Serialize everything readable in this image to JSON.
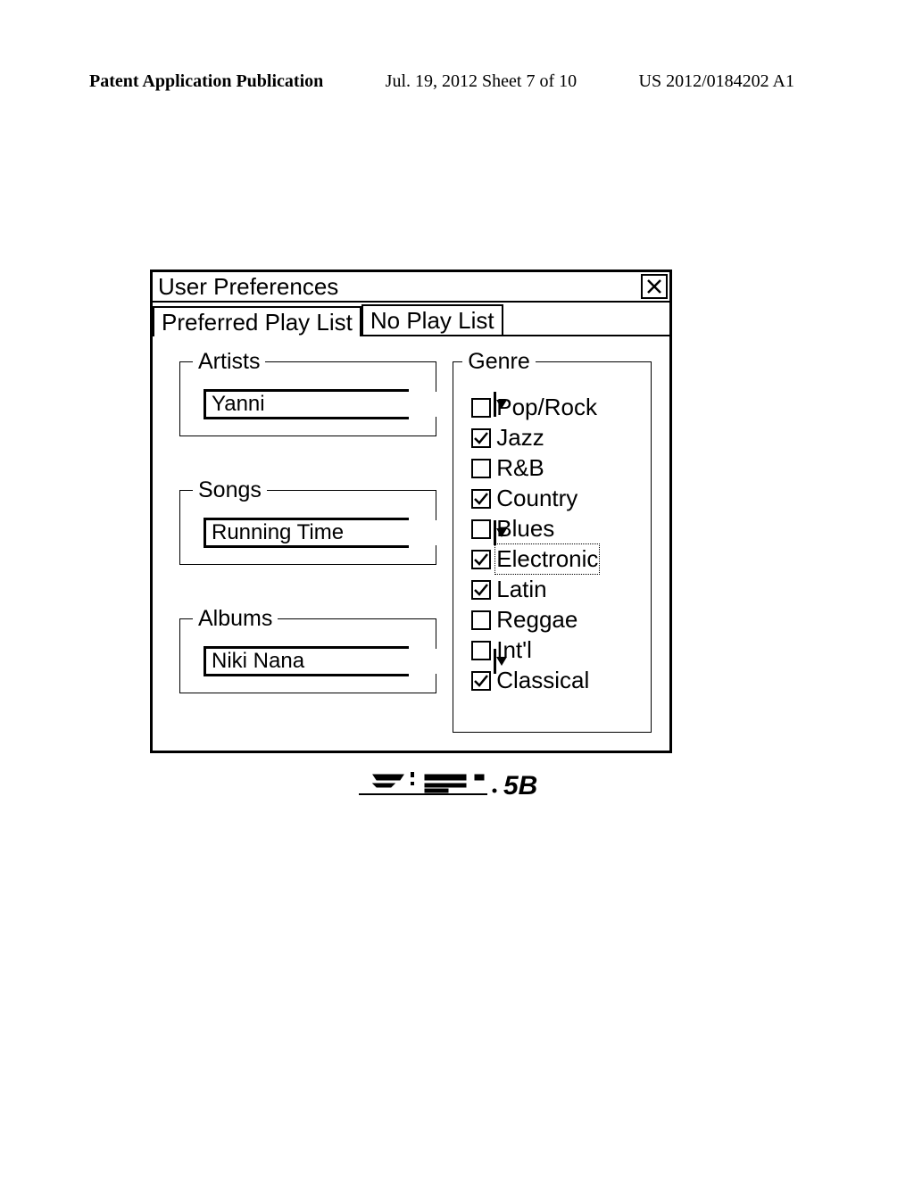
{
  "header": {
    "left": "Patent Application Publication",
    "mid": "Jul. 19, 2012  Sheet 7 of 10",
    "right": "US 2012/0184202 A1"
  },
  "dialog": {
    "title": "User Preferences",
    "tabs": [
      {
        "label": "Preferred Play List",
        "active": true
      },
      {
        "label": "No Play List",
        "active": false
      }
    ],
    "groups": {
      "artists": {
        "legend": "Artists",
        "value": "Yanni"
      },
      "songs": {
        "legend": "Songs",
        "value": "Running Time"
      },
      "albums": {
        "legend": "Albums",
        "value": "Niki Nana"
      }
    },
    "genre": {
      "legend": "Genre",
      "items": [
        {
          "label": "Pop/Rock",
          "checked": false,
          "focus": false
        },
        {
          "label": "Jazz",
          "checked": true,
          "focus": false
        },
        {
          "label": "R&B",
          "checked": false,
          "focus": false
        },
        {
          "label": "Country",
          "checked": true,
          "focus": false
        },
        {
          "label": "Blues",
          "checked": false,
          "focus": false
        },
        {
          "label": "Electronic",
          "checked": true,
          "focus": true
        },
        {
          "label": "Latin",
          "checked": true,
          "focus": false
        },
        {
          "label": "Reggae",
          "checked": false,
          "focus": false
        },
        {
          "label": "Int'l",
          "checked": false,
          "focus": false
        },
        {
          "label": "Classical",
          "checked": true,
          "focus": false
        }
      ]
    }
  },
  "figure_label": "FIG. 5B"
}
